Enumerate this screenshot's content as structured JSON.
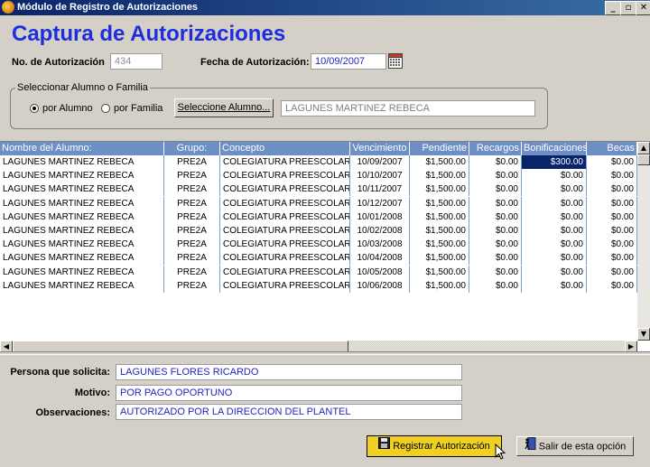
{
  "window": {
    "title": "Módulo de Registro de Autorizaciones",
    "min": "_",
    "max": "▫",
    "close": "✕"
  },
  "header": {
    "title": "Captura de Autorizaciones"
  },
  "form": {
    "no_label": "No. de Autorización",
    "no_value": "434",
    "fecha_label": "Fecha de Autorización:",
    "fecha_value": "10/09/2007"
  },
  "selector": {
    "group_title": "Seleccionar Alumno o Familia",
    "option_alumno": "por Alumno",
    "option_familia": "por Familia",
    "selected": "alumno",
    "button_label": "Seleccione Alumno...",
    "student_name": "LAGUNES MARTINEZ REBECA"
  },
  "grid": {
    "headers": [
      "Nombre del Alumno:",
      "Grupo:",
      "Concepto",
      "Vencimiento",
      "Pendiente",
      "Recargos",
      "Bonificaciones",
      "Becas"
    ],
    "rows": [
      [
        "LAGUNES MARTINEZ REBECA",
        "PRE2A",
        "COLEGIATURA PREESCOLAR...",
        "10/09/2007",
        "$1,500.00",
        "$0.00",
        "$300.00",
        "$0.00"
      ],
      [
        "LAGUNES MARTINEZ REBECA",
        "PRE2A",
        "COLEGIATURA PREESCOLAR...",
        "10/10/2007",
        "$1,500.00",
        "$0.00",
        "$0.00",
        "$0.00"
      ],
      [
        "LAGUNES MARTINEZ REBECA",
        "PRE2A",
        "COLEGIATURA PREESCOLAR...",
        "10/11/2007",
        "$1,500.00",
        "$0.00",
        "$0.00",
        "$0.00"
      ],
      [
        "LAGUNES MARTINEZ REBECA",
        "PRE2A",
        "COLEGIATURA PREESCOLAR...",
        "10/12/2007",
        "$1,500.00",
        "$0.00",
        "$0.00",
        "$0.00"
      ],
      [
        "LAGUNES MARTINEZ REBECA",
        "PRE2A",
        "COLEGIATURA PREESCOLAR...",
        "10/01/2008",
        "$1,500.00",
        "$0.00",
        "$0.00",
        "$0.00"
      ],
      [
        "LAGUNES MARTINEZ REBECA",
        "PRE2A",
        "COLEGIATURA PREESCOLAR...",
        "10/02/2008",
        "$1,500.00",
        "$0.00",
        "$0.00",
        "$0.00"
      ],
      [
        "LAGUNES MARTINEZ REBECA",
        "PRE2A",
        "COLEGIATURA PREESCOLAR...",
        "10/03/2008",
        "$1,500.00",
        "$0.00",
        "$0.00",
        "$0.00"
      ],
      [
        "LAGUNES MARTINEZ REBECA",
        "PRE2A",
        "COLEGIATURA PREESCOLAR...",
        "10/04/2008",
        "$1,500.00",
        "$0.00",
        "$0.00",
        "$0.00"
      ],
      [
        "LAGUNES MARTINEZ REBECA",
        "PRE2A",
        "COLEGIATURA PREESCOLAR...",
        "10/05/2008",
        "$1,500.00",
        "$0.00",
        "$0.00",
        "$0.00"
      ],
      [
        "LAGUNES MARTINEZ REBECA",
        "PRE2A",
        "COLEGIATURA PREESCOLAR...",
        "10/06/2008",
        "$1,500.00",
        "$0.00",
        "$0.00",
        "$0.00"
      ]
    ],
    "selected_row": 0,
    "selected_col": 6
  },
  "details": {
    "solicita_label": "Persona que solicita:",
    "solicita_value": "LAGUNES FLORES RICARDO",
    "motivo_label": "Motivo:",
    "motivo_value": "POR PAGO OPORTUNO",
    "obs_label": "Observaciones:",
    "obs_value": "AUTORIZADO POR LA DIRECCION DEL PLANTEL"
  },
  "actions": {
    "registrar_label": "Registrar Autorización",
    "salir_label": "Salir de esta opción"
  },
  "colors": {
    "title_blue": "#1e2de0",
    "grid_header": "#6e8fc6",
    "selection": "#0a246a",
    "highlight_button": "#f0d020"
  },
  "icons": {
    "app": "app-logo-icon",
    "calendar": "calendar-icon",
    "save": "floppy-disk-icon",
    "exit": "exit-door-icon",
    "cursor": "mouse-cursor-icon"
  }
}
